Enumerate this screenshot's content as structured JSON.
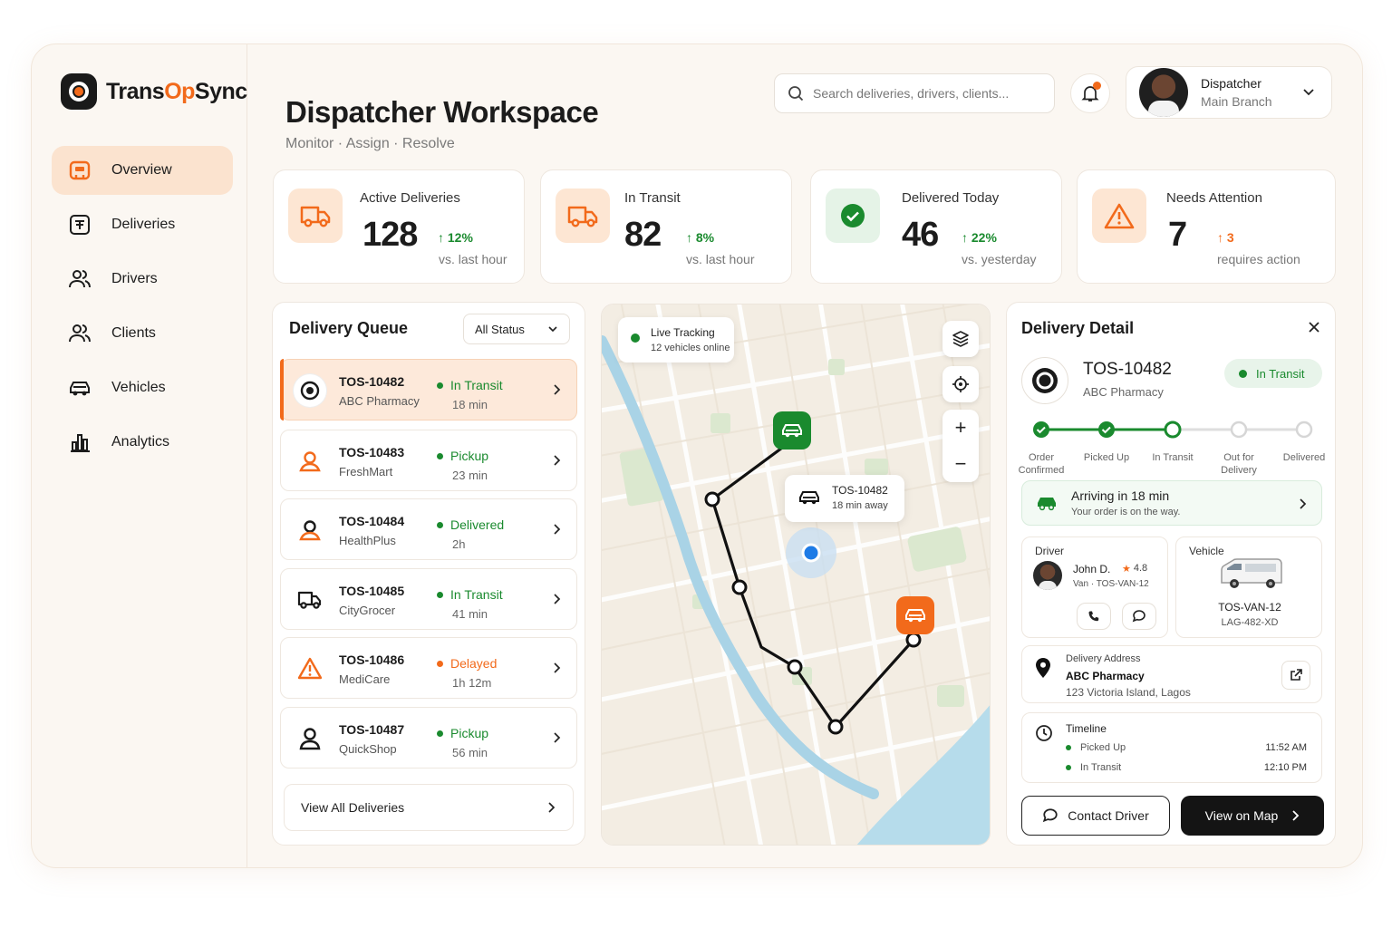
{
  "brand": {
    "name_part1": "Trans",
    "name_part2": "Op",
    "name_part3": "Sync",
    "accent": "#f26a1b"
  },
  "sidebar": {
    "items": [
      {
        "label": "Overview",
        "icon": "overview-icon",
        "active": true
      },
      {
        "label": "Deliveries",
        "icon": "deliveries-icon"
      },
      {
        "label": "Drivers",
        "icon": "drivers-icon"
      },
      {
        "label": "Clients",
        "icon": "clients-icon"
      },
      {
        "label": "Vehicles",
        "icon": "vehicles-icon"
      },
      {
        "label": "Analytics",
        "icon": "analytics-icon"
      }
    ]
  },
  "header": {
    "title": "Dispatcher Workspace",
    "subtitle": "Monitor · Assign · Resolve",
    "search_placeholder": "Search deliveries, drivers, clients...",
    "user": {
      "name": "Dispatcher",
      "role": "Main Branch"
    }
  },
  "stats": [
    {
      "label": "Active Deliveries",
      "value": "128",
      "delta": "12%",
      "note": "vs. last hour",
      "icon": "truck-icon"
    },
    {
      "label": "In Transit",
      "value": "82",
      "delta": "8%",
      "note": "vs. last hour",
      "icon": "truck-icon"
    },
    {
      "label": "Delivered Today",
      "value": "46",
      "delta": "22%",
      "note": "vs. yesterday",
      "icon": "check-circle-icon"
    },
    {
      "label": "Needs Attention",
      "value": "7",
      "delta": "3",
      "note": "requires action",
      "icon": "warning-icon"
    }
  ],
  "queue": {
    "title": "Delivery Queue",
    "filter": "All Status",
    "items": [
      {
        "id": "TOS-10482",
        "client": "ABC Pharmacy",
        "status": "In Transit",
        "time": "18 min",
        "icon": "target-icon"
      },
      {
        "id": "TOS-10483",
        "client": "FreshMart",
        "status": "Pickup",
        "time": "23 min",
        "icon": "person-pin-icon"
      },
      {
        "id": "TOS-10484",
        "client": "HealthPlus",
        "status": "Delivered",
        "time": "2h",
        "icon": "person-pin-icon"
      },
      {
        "id": "TOS-10485",
        "client": "CityGrocer",
        "status": "In Transit",
        "time": "41 min",
        "icon": "truck-icon"
      },
      {
        "id": "TOS-10486",
        "client": "MediCare",
        "status": "Delayed",
        "time": "1h 12m",
        "icon": "warning-icon"
      },
      {
        "id": "TOS-10487",
        "client": "QuickShop",
        "status": "Pickup",
        "time": "56 min",
        "icon": "person-icon"
      }
    ],
    "view_all": "View All Deliveries"
  },
  "map": {
    "live_title": "Live Tracking",
    "live_sub": "12 vehicles online",
    "popup_id": "TOS-10482",
    "popup_eta": "18 min away"
  },
  "detail": {
    "title": "Delivery Detail",
    "id": "TOS-10482",
    "client": "ABC Pharmacy",
    "status": "In Transit",
    "steps": [
      "Order Confirmed",
      "Picked Up",
      "In Transit",
      "Out for Delivery",
      "Delivered"
    ],
    "arriving_title": "Arriving in 18 min",
    "arriving_sub": "Your order is on the way.",
    "driver_label": "Driver",
    "driver_name": "John D.",
    "driver_rating": "4.8",
    "driver_vehicle": "Van · TOS-VAN-12",
    "vehicle_label": "Vehicle",
    "vehicle_id": "TOS-VAN-12",
    "vehicle_plate": "LAG-482-XD",
    "address_label": "Delivery Address",
    "address_name": "ABC Pharmacy",
    "address_line": "123 Victoria Island, Lagos",
    "timeline_label": "Timeline",
    "timeline": [
      {
        "event": "Picked Up",
        "time": "11:52 AM"
      },
      {
        "event": "In Transit",
        "time": "12:10 PM"
      }
    ],
    "contact_btn": "Contact Driver",
    "map_btn": "View on Map"
  }
}
